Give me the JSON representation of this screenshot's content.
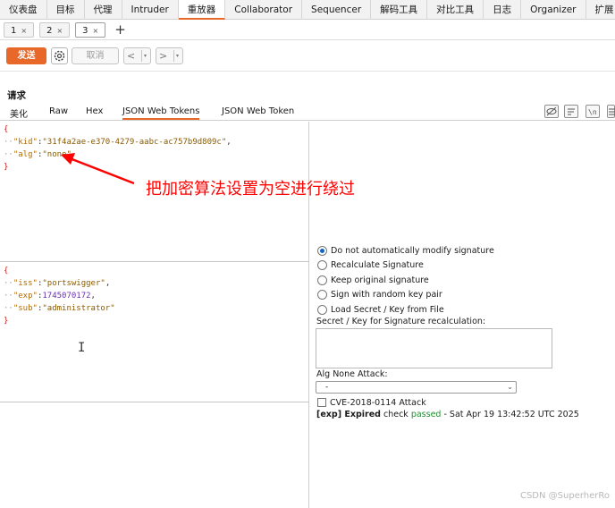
{
  "top_tabs": [
    "仪表盘",
    "目标",
    "代理",
    "Intruder",
    "重放器",
    "Collaborator",
    "Sequencer",
    "解码工具",
    "对比工具",
    "日志",
    "Organizer",
    "扩展"
  ],
  "request_tabs": [
    "1",
    "2",
    "3"
  ],
  "tab_close": "×",
  "add_tab": "+",
  "toolbar": {
    "send": "发送",
    "cancel": "取消",
    "back": "<",
    "forward": ">",
    "dropdown": "▾"
  },
  "request": {
    "title": "请求",
    "subtabs": [
      "美化",
      "Raw",
      "Hex",
      "JSON Web Tokens",
      "JSON Web Token"
    ]
  },
  "header_json": {
    "open": "{",
    "kid_key": "\"kid\"",
    "kid_value": "\"31f4a2ae-e370-4279-aabc-ac757b9d809c\"",
    "alg_key": "\"alg\"",
    "alg_value": "\"none\"",
    "close": "}"
  },
  "payload_json": {
    "open": "{",
    "iss_key": "\"iss\"",
    "iss_value": "\"portswigger\"",
    "exp_key": "\"exp\"",
    "exp_value": "1745070172",
    "sub_key": "\"sub\"",
    "sub_value": "\"administrator\"",
    "close": "}"
  },
  "signature_options": [
    "Do not automatically modify signature",
    "Recalculate Signature",
    "Keep original signature",
    "Sign with random key pair",
    "Load Secret / Key from File"
  ],
  "secret_label": "Secret / Key for Signature recalculation:",
  "alg_none_label": "Alg None Attack:",
  "alg_none_value": "-",
  "cve_label": "CVE-2018-0114 Attack",
  "status": {
    "prefix": "[exp] Expired",
    "check": " check ",
    "passed": "passed",
    "suffix": " - Sat Apr 19 13:42:52 UTC 2025"
  },
  "annotation": "把加密算法设置为空进行绕过",
  "watermark": "CSDN @SuperherRo",
  "colors": {
    "accent": "#e8682a",
    "annotation": "#ff0000",
    "passed": "#1f8c2f"
  }
}
